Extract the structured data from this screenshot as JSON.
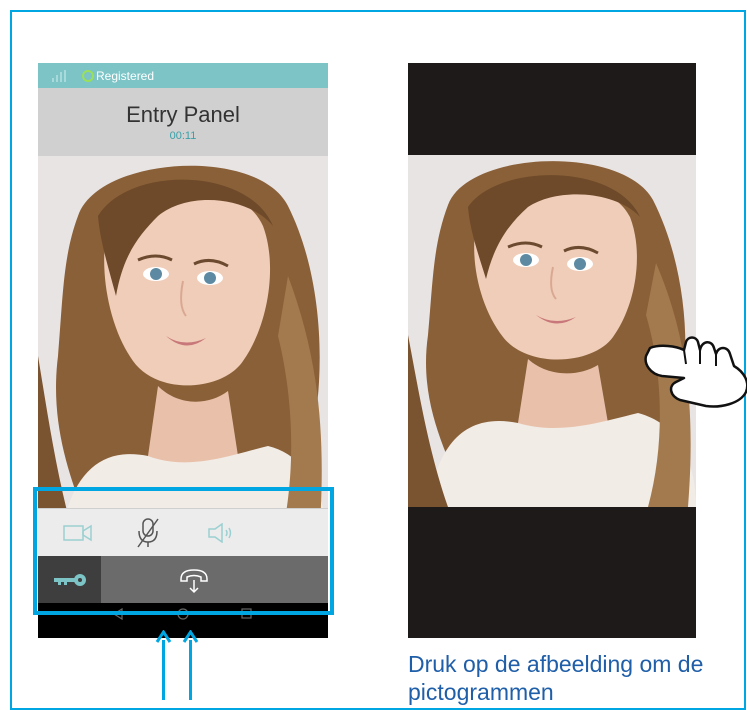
{
  "status_bar": {
    "registration": "Registered"
  },
  "call": {
    "callee": "Entry Panel",
    "timer": "00:11"
  },
  "controls": [
    "video-camera",
    "microphone-muted",
    "speaker"
  ],
  "actions": {
    "unlock": "key-icon",
    "hangup": "hang-up-icon"
  },
  "caption": "Druk op de afbeelding om de pictogrammen",
  "colors": {
    "accent": "#00a6e2",
    "status_bar": "#7cc4c6",
    "caption": "#1f5ea8",
    "registered": "#9be05a"
  }
}
